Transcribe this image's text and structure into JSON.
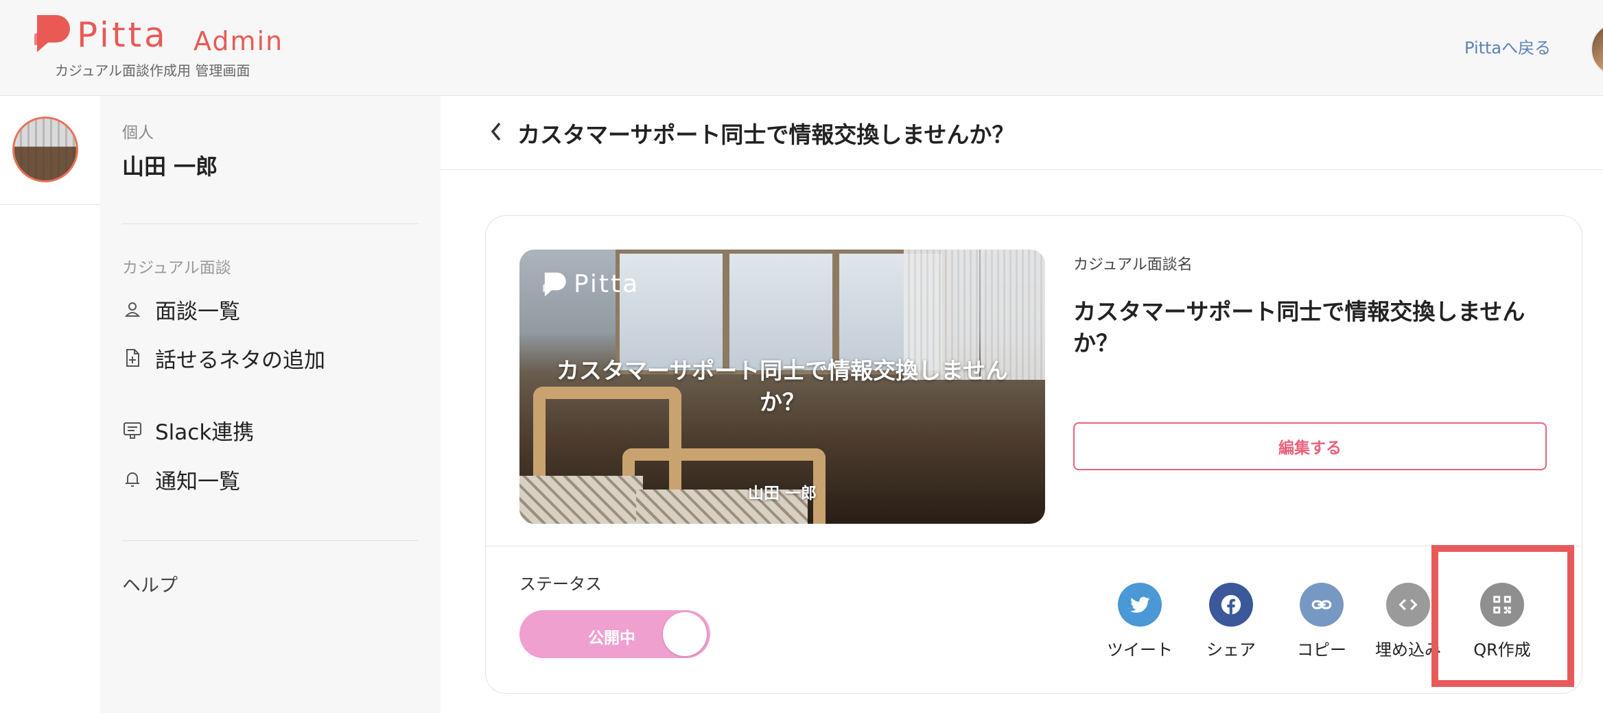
{
  "header": {
    "logo_text": "Pitta",
    "logo_suffix": "Admin",
    "subtitle": "カジュアル面談作成用 管理画面",
    "back_link": "Pittaへ戻る"
  },
  "sidebar": {
    "org_label": "個人",
    "user_name": "山田 一郎",
    "section_label": "カジュアル面談",
    "items": [
      {
        "label": "面談一覧",
        "icon": "person-icon"
      },
      {
        "label": "話せるネタの追加",
        "icon": "document-add-icon"
      },
      {
        "label": "Slack連携",
        "icon": "slack-integration-icon"
      },
      {
        "label": "通知一覧",
        "icon": "bell-icon"
      }
    ],
    "help": "ヘルプ"
  },
  "page": {
    "title": "カスタマーサポート同士で情報交換しませんか？"
  },
  "card": {
    "thumbnail": {
      "logo_text": "Pitta",
      "title": "カスタマーサポート同士で情報交換しませんか？",
      "author": "山田 一郎"
    },
    "field_label": "カジュアル面談名",
    "field_value": "カスタマーサポート同士で情報交換しませんか？",
    "edit_button": "編集する",
    "status_label": "ステータス",
    "status_value": "公開中",
    "status_on": true,
    "share": [
      {
        "label": "ツイート",
        "icon": "twitter-icon",
        "color": "#4a98d6"
      },
      {
        "label": "シェア",
        "icon": "facebook-icon",
        "color": "#3b589a"
      },
      {
        "label": "コピー",
        "icon": "link-icon",
        "color": "#7898c4"
      },
      {
        "label": "埋め込み",
        "icon": "code-icon",
        "color": "#9a9a9a"
      },
      {
        "label": "QR作成",
        "icon": "qr-code-icon",
        "color": "#8f8f8f"
      }
    ]
  },
  "colors": {
    "brand": "#e95a55",
    "edit_accent": "#e8637a",
    "toggle_on": "#f0a0cf",
    "highlight": "#e85a5a"
  }
}
